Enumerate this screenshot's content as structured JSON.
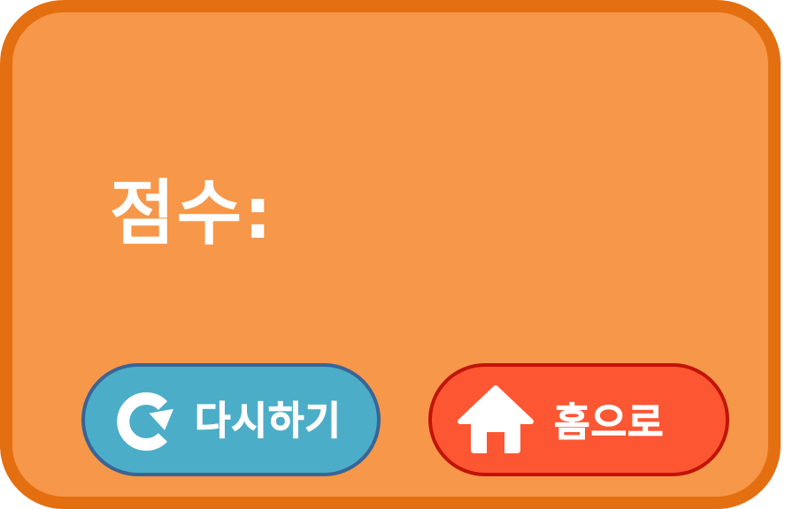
{
  "score": {
    "label": "점수:"
  },
  "buttons": {
    "retry": {
      "label": "다시하기",
      "icon": "refresh-icon",
      "color": "#4cadc8"
    },
    "home": {
      "label": "홈으로",
      "icon": "home-icon",
      "color": "#fd5632"
    }
  },
  "colors": {
    "panel": "#f69749",
    "panel_border": "#e46f10"
  }
}
